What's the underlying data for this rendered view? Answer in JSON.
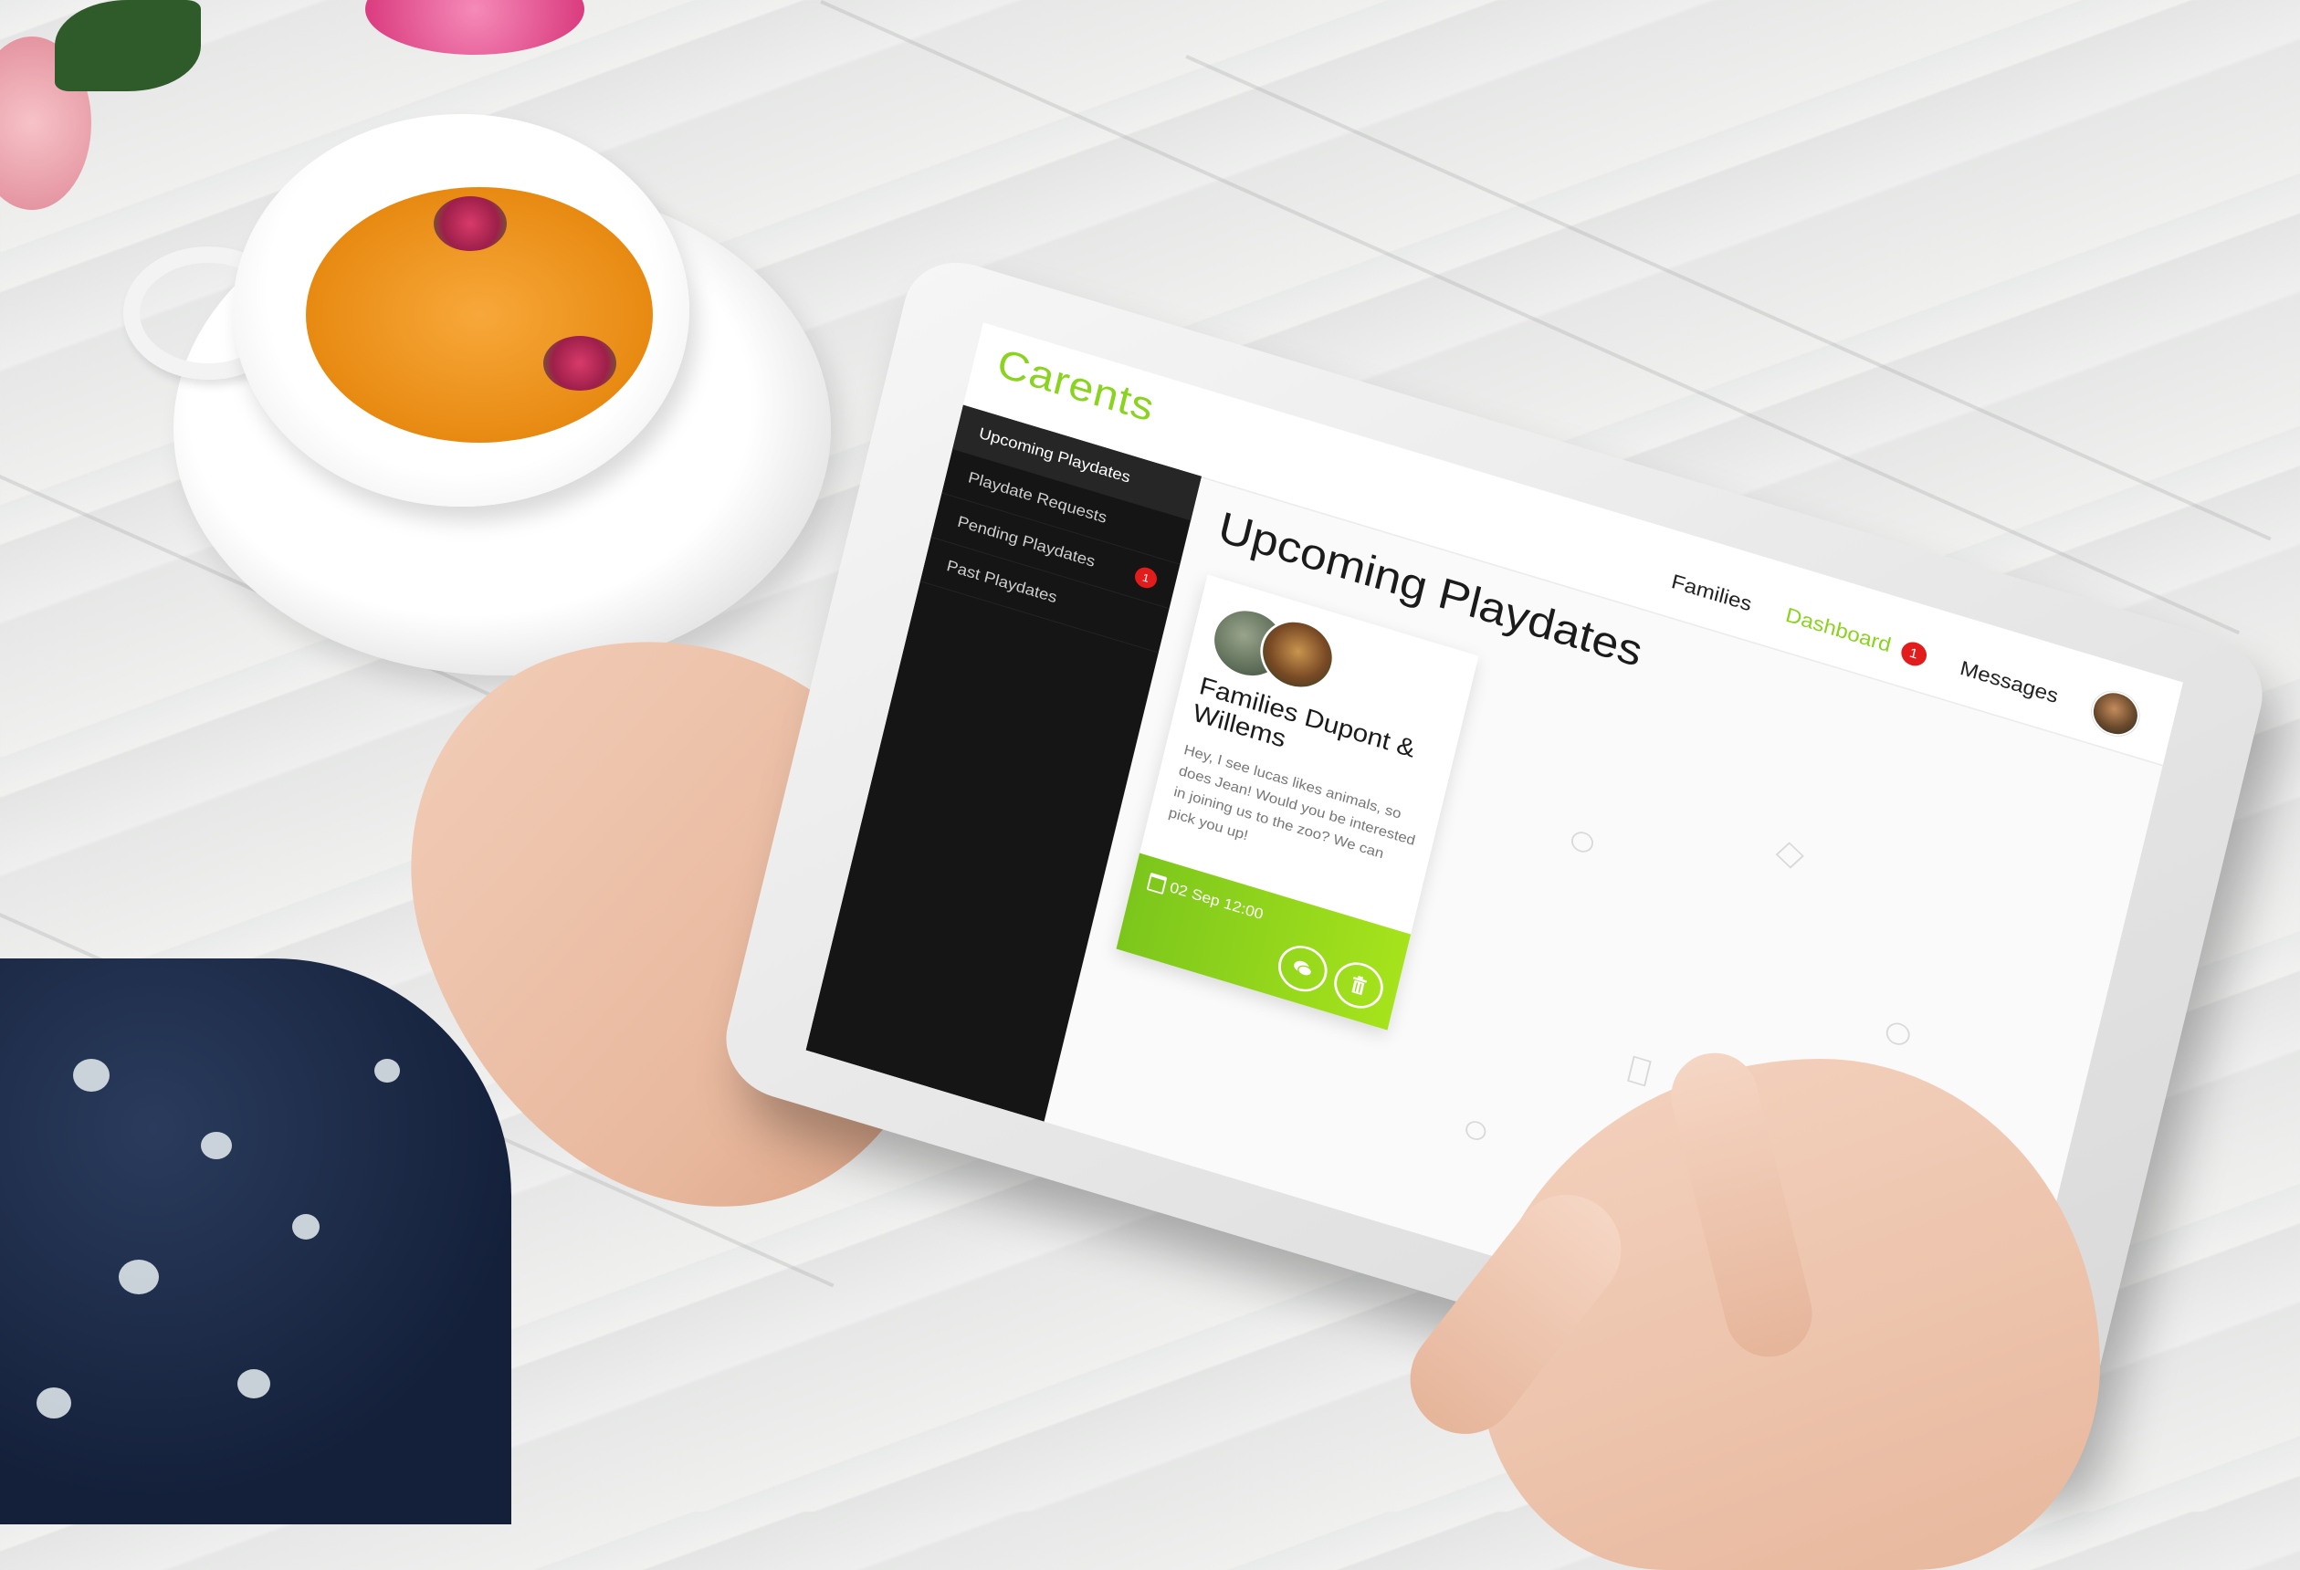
{
  "app": {
    "logo": "Carents"
  },
  "nav": {
    "families": "Families",
    "dashboard": "Dashboard",
    "dashboard_badge": "1",
    "messages": "Messages"
  },
  "sidebar": {
    "items": [
      {
        "label": "Upcoming Playdates",
        "active": true
      },
      {
        "label": "Playdate Requests",
        "active": false
      },
      {
        "label": "Pending Playdates",
        "active": false,
        "badge": "1"
      },
      {
        "label": "Past Playdates",
        "active": false
      }
    ]
  },
  "main": {
    "title": "Upcoming Playdates",
    "card": {
      "title": "Families Dupont & Willems",
      "text": "Hey, I see lucas likes animals, so does Jean! Would you be interested in joining us to the zoo? We can pick you up!",
      "date": "02 Sep 12:00",
      "actions": [
        "chat-icon",
        "trash-icon"
      ]
    }
  },
  "colors": {
    "accent": "#8ad31f",
    "sidebar_bg": "#151515",
    "badge": "#e21c1c"
  }
}
